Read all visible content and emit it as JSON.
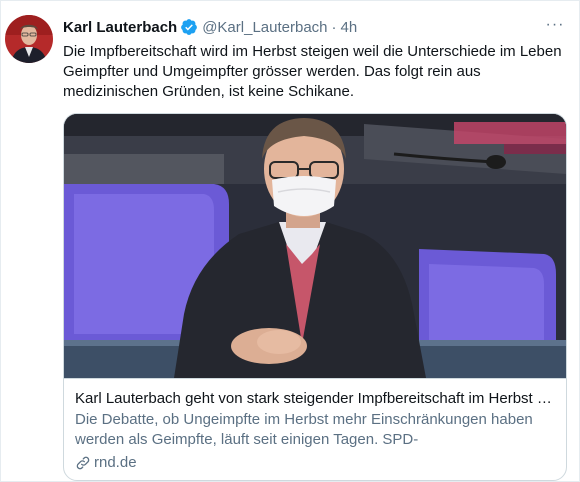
{
  "tweet": {
    "display_name": "Karl Lauterbach",
    "handle": "@Karl_Lauterbach",
    "separator": "·",
    "time": "4h",
    "more_label": "···",
    "text": "Die Impfbereitschaft wird im Herbst steigen weil die Unterschiede im Leben\nGeimpfter und Umgeimpfter grösser werden. Das folgt rein aus\nmedizinischen Gründen, ist keine Schikane.",
    "verified_icon": "verified-badge-icon",
    "colors": {
      "verified": "#1da1f2",
      "secondary_text": "#5b7083",
      "border": "#cfd9de"
    }
  },
  "card": {
    "title": "Karl Lauterbach geht von stark steigender Impfbereitschaft im Herbst a...",
    "description": "Die Debatte, ob Ungeimpfte im Herbst mehr Einschränkungen haben werden als Geimpfte, läuft seit einigen Tagen. SPD-Gesundheitsexperte...",
    "domain": "rnd.de",
    "link_icon": "link-icon",
    "image_subject": "card-image"
  }
}
